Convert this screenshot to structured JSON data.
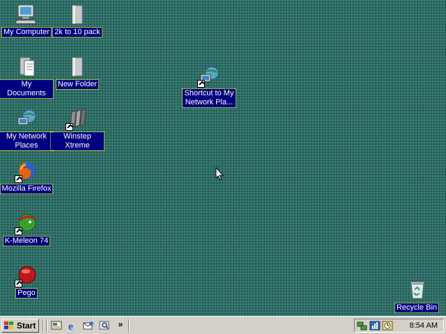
{
  "desktop": {
    "icons": [
      {
        "label": "My Computer",
        "icon": "computer-icon"
      },
      {
        "label": "2k to 10 pack",
        "icon": "folder-icon"
      },
      {
        "label": "My Documents",
        "icon": "documents-icon"
      },
      {
        "label": "New Folder",
        "icon": "folder-icon"
      },
      {
        "label": "Shortcut to My Network Pla...",
        "icon": "network-places-icon"
      },
      {
        "label": "My Network Places",
        "icon": "network-places-icon"
      },
      {
        "label": "Winstep Xtreme",
        "icon": "winstep-icon"
      },
      {
        "label": "Mozilla Firefox",
        "icon": "firefox-icon"
      },
      {
        "label": "K-Meleon 74",
        "icon": "kmeleon-icon"
      },
      {
        "label": "Pego",
        "icon": "pego-icon"
      },
      {
        "label": "Recycle Bin",
        "icon": "recycle-bin-icon"
      }
    ],
    "background_color": "#2f6e68",
    "selection_color": "#000080"
  },
  "taskbar": {
    "start_label": "Start",
    "quick_launch": [
      "show-desktop-icon",
      "internet-explorer-icon",
      "outlook-express-icon",
      "search-icon"
    ],
    "overflow": "»",
    "tray_icons": [
      "network-tray-icon",
      "volume-tray-icon",
      "task-scheduler-tray-icon"
    ],
    "clock": "8:54 AM"
  }
}
